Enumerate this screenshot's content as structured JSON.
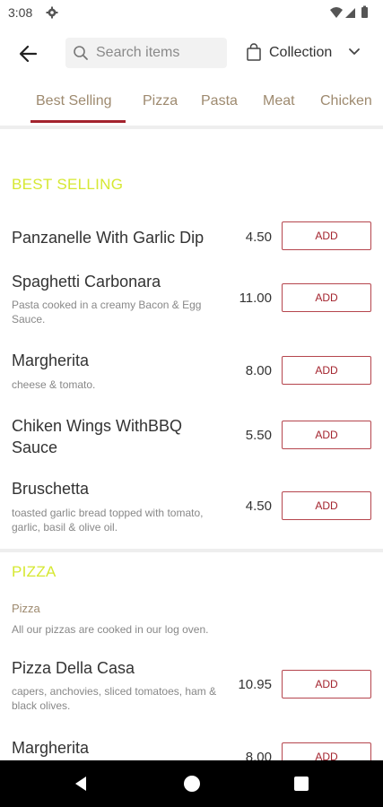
{
  "status_bar": {
    "time": "3:08"
  },
  "header": {
    "search": {
      "placeholder": "Search items",
      "value": ""
    },
    "collection_label": "Collection"
  },
  "tabs": [
    {
      "label": "Best Selling",
      "active": true
    },
    {
      "label": "Pizza",
      "active": false
    },
    {
      "label": "Pasta",
      "active": false
    },
    {
      "label": "Meat",
      "active": false
    },
    {
      "label": "Chicken",
      "active": false
    }
  ],
  "sections": [
    {
      "title": "BEST SELLING",
      "items": [
        {
          "name": "Panzanelle With Garlic Dip",
          "desc": "",
          "price": "4.50",
          "button": "ADD"
        },
        {
          "name": "Spaghetti Carbonara",
          "desc": "Pasta cooked in a creamy Bacon & Egg Sauce.",
          "price": "11.00",
          "button": "ADD"
        },
        {
          "name": "Margherita",
          "desc": "cheese & tomato.",
          "price": "8.00",
          "button": "ADD"
        },
        {
          "name": "Chiken Wings WithBBQ Sauce",
          "desc": "",
          "price": "5.50",
          "button": "ADD"
        },
        {
          "name": "Bruschetta",
          "desc": "toasted garlic bread topped with tomato, garlic, basil & olive oil.",
          "price": "4.50",
          "button": "ADD"
        }
      ]
    },
    {
      "title": "PIZZA",
      "subtitle": "Pizza",
      "subdesc": "All our pizzas are cooked in our log oven.",
      "items": [
        {
          "name": "Pizza Della Casa",
          "desc": "capers, anchovies, sliced tomatoes, ham & black olives.",
          "price": "10.95",
          "button": "ADD"
        },
        {
          "name": "Margherita",
          "desc": "",
          "price": "8.00",
          "button": "ADD"
        }
      ]
    }
  ],
  "colors": {
    "accent": "#a3232d",
    "section_title": "#d6e832",
    "tab_text": "#9e8a6f"
  }
}
